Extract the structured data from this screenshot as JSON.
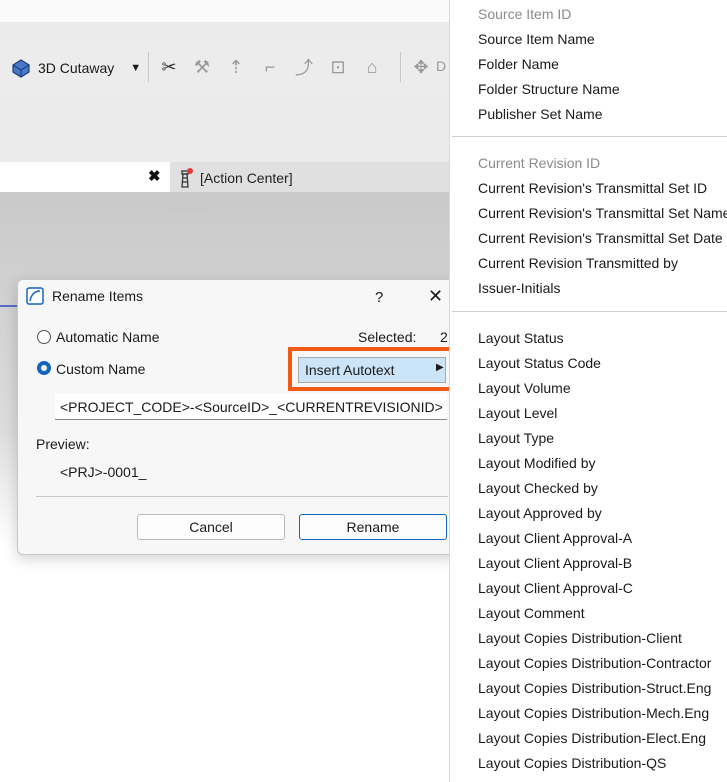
{
  "toolbar": {
    "view_mode": "3D Cutaway",
    "icons": [
      "scissors-icon",
      "hammer-icon",
      "elevation-icon",
      "corner-icon",
      "curve-icon",
      "fit-icon",
      "home-icon",
      "pan-icon"
    ],
    "truncated_label": "D"
  },
  "tabs": {
    "tab2_label": "[Action Center]"
  },
  "dialog": {
    "title": "Rename Items",
    "help": "?",
    "close": "✕",
    "automatic_label": "Automatic Name",
    "custom_label": "Custom Name",
    "selected_label": "Selected:",
    "selected_count": "2",
    "insert_autotext_label": "Insert Autotext",
    "pattern_value": "<PROJECT_CODE>-<SourceID>_<CURRENTREVISIONID>",
    "preview_label": "Preview:",
    "preview_value": "<PRJ>-0001_",
    "cancel_label": "Cancel",
    "rename_label": "Rename",
    "selected_option": "custom",
    "accent_color": "#1565c0",
    "highlight_color": "#f05a14"
  },
  "menu": {
    "group1": [
      {
        "label": "Source Item ID",
        "disabled": true
      },
      {
        "label": "Source Item Name",
        "disabled": false
      },
      {
        "label": "Folder Name",
        "disabled": false
      },
      {
        "label": "Folder Structure Name",
        "disabled": false
      },
      {
        "label": "Publisher Set Name",
        "disabled": false
      }
    ],
    "group2": [
      {
        "label": "Current Revision ID",
        "disabled": true
      },
      {
        "label": "Current Revision's Transmittal Set ID",
        "disabled": false
      },
      {
        "label": "Current Revision's Transmittal Set Name",
        "disabled": false
      },
      {
        "label": "Current Revision's Transmittal Set Date",
        "disabled": false
      },
      {
        "label": "Current Revision Transmitted by",
        "disabled": false
      },
      {
        "label": "Issuer-Initials",
        "disabled": false
      }
    ],
    "group3": [
      {
        "label": "Layout Status",
        "disabled": false
      },
      {
        "label": "Layout Status Code",
        "disabled": false
      },
      {
        "label": "Layout Volume",
        "disabled": false
      },
      {
        "label": "Layout Level",
        "disabled": false
      },
      {
        "label": "Layout Type",
        "disabled": false
      },
      {
        "label": "Layout Modified by",
        "disabled": false
      },
      {
        "label": "Layout Checked by",
        "disabled": false
      },
      {
        "label": "Layout Approved by",
        "disabled": false
      },
      {
        "label": "Layout Client Approval-A",
        "disabled": false
      },
      {
        "label": "Layout Client Approval-B",
        "disabled": false
      },
      {
        "label": "Layout Client Approval-C",
        "disabled": false
      },
      {
        "label": "Layout Comment",
        "disabled": false
      },
      {
        "label": "Layout Copies Distribution-Client",
        "disabled": false
      },
      {
        "label": "Layout Copies Distribution-Contractor",
        "disabled": false
      },
      {
        "label": "Layout Copies Distribution-Struct.Eng",
        "disabled": false
      },
      {
        "label": "Layout Copies Distribution-Mech.Eng",
        "disabled": false
      },
      {
        "label": "Layout Copies Distribution-Elect.Eng",
        "disabled": false
      },
      {
        "label": "Layout Copies Distribution-QS",
        "disabled": false
      }
    ]
  }
}
